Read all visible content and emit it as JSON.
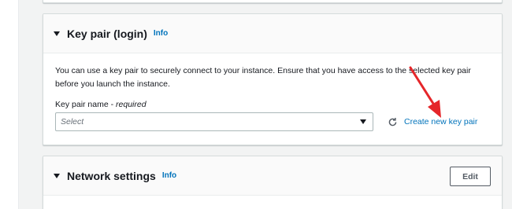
{
  "keypair_section": {
    "title": "Key pair (login)",
    "info_label": "Info",
    "description": "You can use a key pair to securely connect to your instance. Ensure that you have access to the selected key pair before you launch the instance.",
    "field_label": "Key pair name - ",
    "field_required": "required",
    "select_placeholder": "Select",
    "create_link": "Create new key pair"
  },
  "network_section": {
    "title": "Network settings",
    "info_label": "Info",
    "edit_label": "Edit"
  },
  "colors": {
    "link": "#0073bb",
    "annotation_arrow": "#e5262a"
  }
}
